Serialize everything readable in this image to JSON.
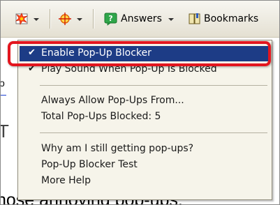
{
  "toolbar": {
    "answers_label": "Answers",
    "bookmarks_label": "Bookmarks"
  },
  "menu": {
    "items": [
      {
        "label": "Enable Pop-Up Blocker",
        "checked": true,
        "selected": true
      },
      {
        "label": "Play Sound When Pop-Up Is Blocked",
        "checked": true
      },
      {
        "label": "Always Allow Pop-Ups From..."
      },
      {
        "label": "Total Pop-Ups Blocked: 5"
      },
      {
        "label": "Why am I still getting pop-ups?"
      },
      {
        "label": "Pop-Up Blocker Test"
      },
      {
        "label": "More Help"
      }
    ],
    "check_glyph": "✔"
  },
  "page_fragments": {
    "left_char_1": "o",
    "left_char_2": "T",
    "bottom_text": "hose annoying pop-ups."
  },
  "colors": {
    "selection": "#1d3c86",
    "highlight_outline": "#e3161f",
    "menu_bg": "#f6f4ea"
  }
}
